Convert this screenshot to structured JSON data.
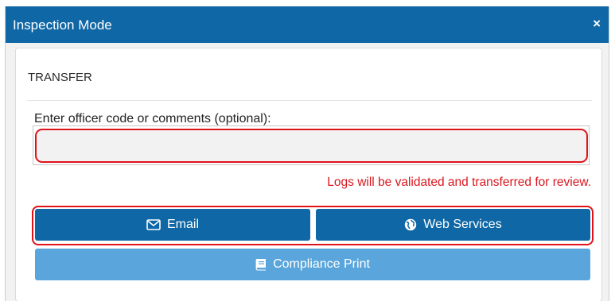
{
  "window": {
    "title": "Inspection Mode",
    "close_label": "×"
  },
  "transfer": {
    "section_title": "TRANSFER",
    "field_label": "Enter officer code or comments (optional):",
    "input_value": "",
    "input_placeholder": "",
    "notice": "Logs will be validated and transferred for review."
  },
  "buttons": {
    "email": {
      "label": "Email",
      "icon": "envelope-icon"
    },
    "web_services": {
      "label": "Web Services",
      "icon": "globe-icon"
    },
    "compliance_print": {
      "label": "Compliance Print",
      "icon": "book-icon"
    }
  },
  "colors": {
    "header": "#0f67a6",
    "primary_button": "#0f67a6",
    "secondary_button": "#5aa6dc",
    "highlight": "#e0121a",
    "notice_text": "#d9171f"
  }
}
